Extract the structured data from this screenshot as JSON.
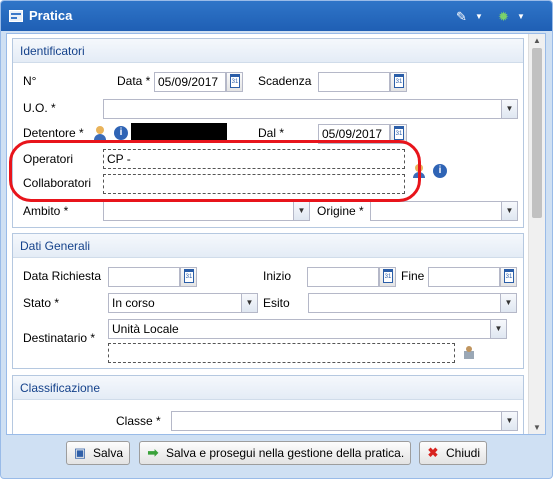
{
  "window": {
    "title": "Pratica",
    "tools": [
      "brush-icon",
      "gear-icon"
    ]
  },
  "identificatori": {
    "legend": "Identificatori",
    "n_label": "N°",
    "data_label": "Data *",
    "data_value": "05/09/2017",
    "scadenza_label": "Scadenza",
    "scadenza_value": "",
    "uo_label": "U.O. *",
    "uo_value": "",
    "detentore_label": "Detentore *",
    "dal_label": "Dal *",
    "dal_value": "05/09/2017",
    "operatori_label": "Operatori",
    "operatori_value": "CP -",
    "collaboratori_label": "Collaboratori",
    "collaboratori_value": "",
    "ambito_label": "Ambito *",
    "ambito_value": "",
    "origine_label": "Origine *",
    "origine_value": ""
  },
  "dati_generali": {
    "legend": "Dati Generali",
    "data_richiesta_label": "Data Richiesta",
    "data_richiesta_value": "",
    "inizio_label": "Inizio",
    "inizio_value": "",
    "fine_label": "Fine",
    "fine_value": "",
    "stato_label": "Stato *",
    "stato_value": "In corso",
    "esito_label": "Esito",
    "esito_value": "",
    "destinatario_label": "Destinatario *",
    "destinatario_value": "Unità Locale",
    "destinatario_detail": ""
  },
  "classificazione": {
    "legend": "Classificazione",
    "classe_label": "Classe *",
    "classe_value": ""
  },
  "footer": {
    "salva": "Salva",
    "salva_prosegui": "Salva e prosegui nella gestione della pratica.",
    "chiudi": "Chiudi"
  },
  "colors": {
    "title_bar": "#2f75c8",
    "highlight": "#e8141b",
    "legend_text": "#15428b"
  }
}
